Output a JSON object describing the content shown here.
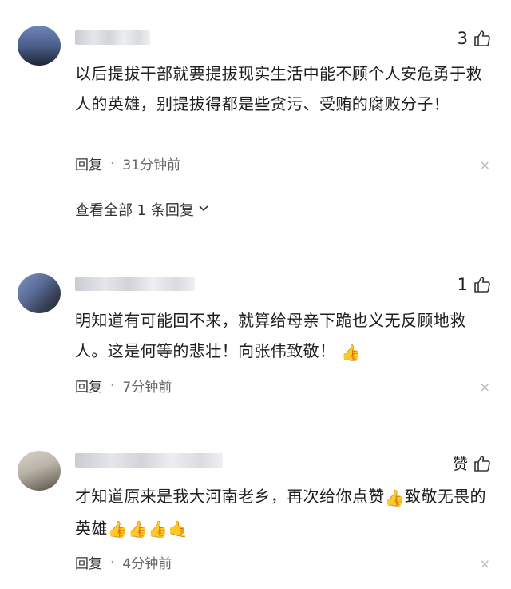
{
  "comments": [
    {
      "likes": "3",
      "text": "以后提拔干部就要提拔现实生活中能不顾个人安危勇于救人的英雄，别提拔得都是些贪污、受贿的腐败分子！",
      "reply_label": "回复",
      "separator": "·",
      "time": "31分钟前",
      "view_all": "查看全部 1 条回复"
    },
    {
      "likes": "1",
      "text": "明知道有可能回不来，就算给母亲下跪也义无反顾地救人。这是何等的悲壮！向张伟致敬",
      "text_tail": "！",
      "emoji": "👍",
      "reply_label": "回复",
      "separator": "·",
      "time": "7分钟前"
    },
    {
      "likes": "赞",
      "text_a": "才知道原来是我大河南老乡，再次给你点赞",
      "emoji_mid": "👍",
      "text_b": "致敬无畏的英雄",
      "emoji_tail": "👍👍👍🤙",
      "reply_label": "回复",
      "separator": "·",
      "time": "4分钟前"
    }
  ],
  "close_symbol": "×",
  "colors": {
    "text": "#1f1f1f",
    "meta": "#666666",
    "divider": "#ececec"
  }
}
